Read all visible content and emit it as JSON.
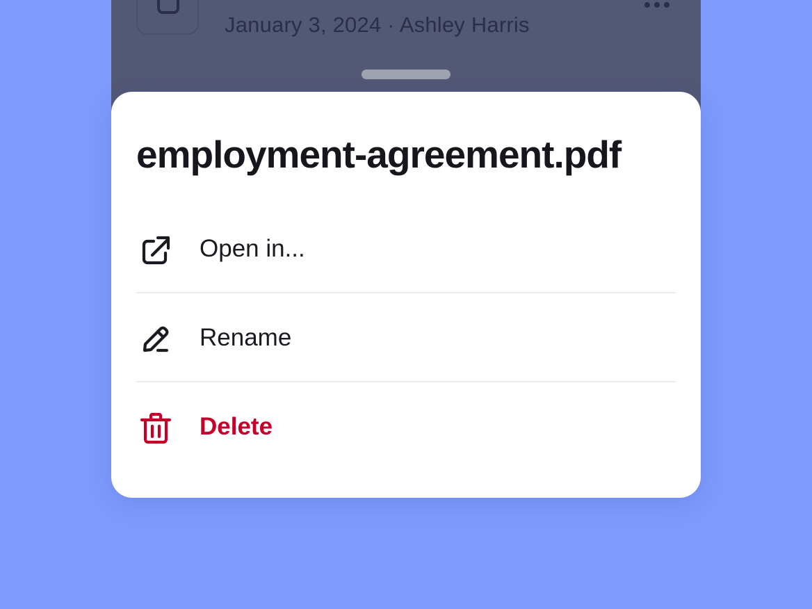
{
  "background": {
    "page_color": "#7f9bfd",
    "screen_color": "#535874"
  },
  "file": {
    "meta": "January 3, 2024 · Ashley Harris",
    "thumb_icon": "document-icon",
    "more_icon": "more-horizontal-icon"
  },
  "sheet": {
    "title": "employment-agreement.pdf",
    "items": [
      {
        "label": "Open in...",
        "icon": "external-link-icon",
        "color": "#1a1b20"
      },
      {
        "label": "Rename",
        "icon": "pencil-icon",
        "color": "#1a1b20"
      },
      {
        "label": "Delete",
        "icon": "trash-icon",
        "color": "#c4002b"
      }
    ]
  }
}
